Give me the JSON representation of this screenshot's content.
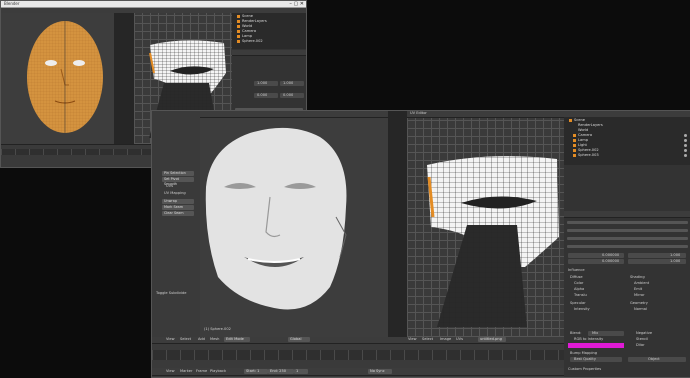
{
  "win1": {
    "title": "Blender",
    "outliner_items": [
      "Scene",
      "RenderLayers",
      "World",
      "Camera",
      "Lamp",
      "Sphere.002"
    ],
    "field_values": [
      "1.000",
      "1.000",
      "0.000",
      "0.000"
    ]
  },
  "win2": {
    "uv_header": "UV Editor",
    "view3d_label": "(1) Sphere.002",
    "tool_items": [
      "Pin Selection",
      "Set Pivot Smooth",
      "UVs",
      "UV Mapping",
      "Unwrap",
      "Mark Seam",
      "Clear Seam",
      "Toggle Subdivide"
    ],
    "view3d_menu": [
      "View",
      "Select",
      "Add",
      "Mesh"
    ],
    "mode": "Edit Mode",
    "pivot": "Global",
    "uv_menu": [
      "View",
      "Select",
      "Image",
      "UVs"
    ],
    "image_name": "untitled.png",
    "outliner_items": [
      "Scene",
      "RenderLayers",
      "World",
      "Camera",
      "Lamp",
      "Light",
      "Sphere.002",
      "Sphere.003"
    ],
    "props": {
      "influence": "Influence",
      "diffuse": "Diffuse",
      "shading": "Shading",
      "specular": "Specular",
      "geometry": "Geometry",
      "rows_left": [
        "Color",
        "Alpha",
        "Translu",
        "Intensity"
      ],
      "rows_right": [
        "Ambient",
        "Emit",
        "Mirror",
        "Normal"
      ],
      "values": [
        "0.000000",
        "0.000000",
        "1.000",
        "1.000"
      ],
      "blend": "Mix",
      "rgb_label": "RGB to Intensity",
      "dvar": "DVar",
      "negative": "Negative",
      "stencil": "Stencil",
      "bump_mapping": "Bump Mapping",
      "method": "Best Quality",
      "space": "Object",
      "custom_props": "Custom Properties"
    },
    "timeline_menu": [
      "View",
      "Marker",
      "Frame",
      "Playback"
    ],
    "start": "Start: 1",
    "end": "End: 250",
    "frame": "1",
    "sync": "No Sync"
  }
}
